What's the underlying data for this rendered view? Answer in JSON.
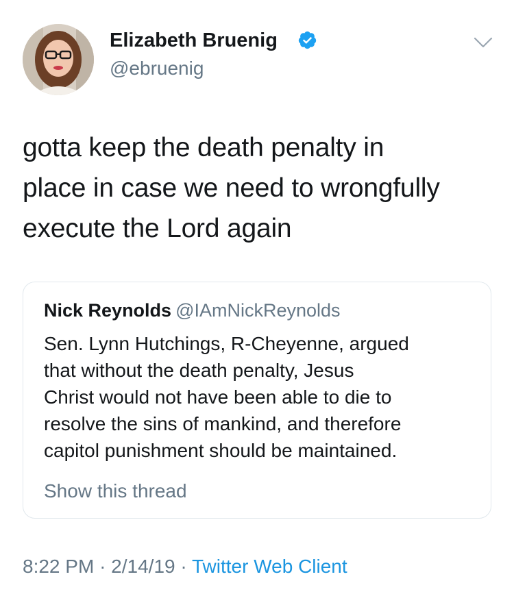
{
  "author": {
    "name": "Elizabeth Bruenig",
    "handle": "@ebruenig",
    "verified": true
  },
  "tweet": {
    "text_lines": [
      "gotta keep the death penalty in",
      "place in case we need to wrongfully",
      "execute the Lord again"
    ]
  },
  "quote": {
    "name": "Nick Reynolds",
    "handle": "@IAmNickReynolds",
    "text_lines": [
      "Sen. Lynn Hutchings, R-Cheyenne, argued",
      "that without the death penalty, Jesus",
      "Christ would not have been able to die to",
      "resolve the sins of mankind, and therefore",
      "capitol punishment should be maintained."
    ],
    "show_thread": "Show this thread"
  },
  "meta": {
    "time": "8:22 PM",
    "separator": "·",
    "date": "2/14/19",
    "source": "Twitter Web Client"
  },
  "icons": {
    "verified": "verified-badge-icon",
    "menu": "chevron-down-icon"
  },
  "colors": {
    "text": "#14171a",
    "secondary": "#657786",
    "link": "#1b95e0",
    "verified": "#1da1f2",
    "border": "#e1e8ed"
  }
}
